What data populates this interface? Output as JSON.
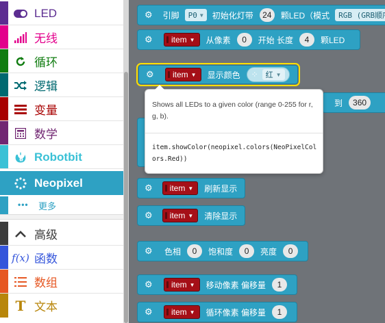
{
  "toolbox": {
    "categories": [
      {
        "label": "LED",
        "icon": "toggle-icon",
        "color": "#5c2d91"
      },
      {
        "label": "无线",
        "icon": "signal-bars-icon",
        "color": "#e3008c"
      },
      {
        "label": "循环",
        "icon": "refresh-icon",
        "color": "#107c10"
      },
      {
        "label": "逻辑",
        "icon": "shuffle-icon",
        "color": "#006970"
      },
      {
        "label": "变量",
        "icon": "list-lines-icon",
        "color": "#a80000"
      },
      {
        "label": "数学",
        "icon": "calculator-icon",
        "color": "#712672"
      },
      {
        "label": "Robotbit",
        "icon": "rebel-icon",
        "color": "#3ac1d6"
      },
      {
        "label": "Neopixel",
        "icon": "dotted-circle-icon",
        "color": "#2ea1c3"
      }
    ],
    "more_label": "更多",
    "more_icon": "dots-icon",
    "advanced": [
      {
        "label": "高级",
        "icon": "chevron-up-icon",
        "color": "#3c3c3c"
      },
      {
        "label": "函数",
        "icon": "function-icon",
        "color": "#3455db"
      },
      {
        "label": "数组",
        "icon": "ordered-list-icon",
        "color": "#e65722"
      },
      {
        "label": "文本",
        "icon": "text-t-icon",
        "color": "#b8860b"
      }
    ]
  },
  "blocks": {
    "strip": {
      "t1": "引脚",
      "pin": "P0",
      "t2": "初始化灯带",
      "count": "24",
      "t3": "颗LED（模式",
      "mode": "RGB (GRB顺序"
    },
    "range": {
      "var": "item",
      "t1": "从像素",
      "start": "0",
      "t2": "开始 长度",
      "length": "4",
      "t3": "颗LED"
    },
    "show_color": {
      "var": "item",
      "t1": "显示颜色",
      "color": "红"
    },
    "rainbow": {
      "t1": "到",
      "end": "360"
    },
    "show": {
      "var": "item",
      "t1": "刷新显示"
    },
    "clear": {
      "var": "item",
      "t1": "清除显示"
    },
    "hsl": {
      "t1": "色相",
      "h": "0",
      "t2": "饱和度",
      "s": "0",
      "t3": "亮度",
      "l": "0"
    },
    "shift": {
      "var": "item",
      "t1": "移动像素 偏移量",
      "offset": "1"
    },
    "rotate": {
      "var": "item",
      "t1": "循环像素 偏移量",
      "offset": "1"
    }
  },
  "tooltip": {
    "description": "Shows all LEDs to a given color (range 0-255 for r, g, b).",
    "code": "item.showColor(neopixel.colors(NeoPixelColors.Red))"
  },
  "colors": {
    "block": "#2ea1c3",
    "variable": "#a50f17",
    "highlight": "#fbe100",
    "workspace": "#6f7378"
  }
}
